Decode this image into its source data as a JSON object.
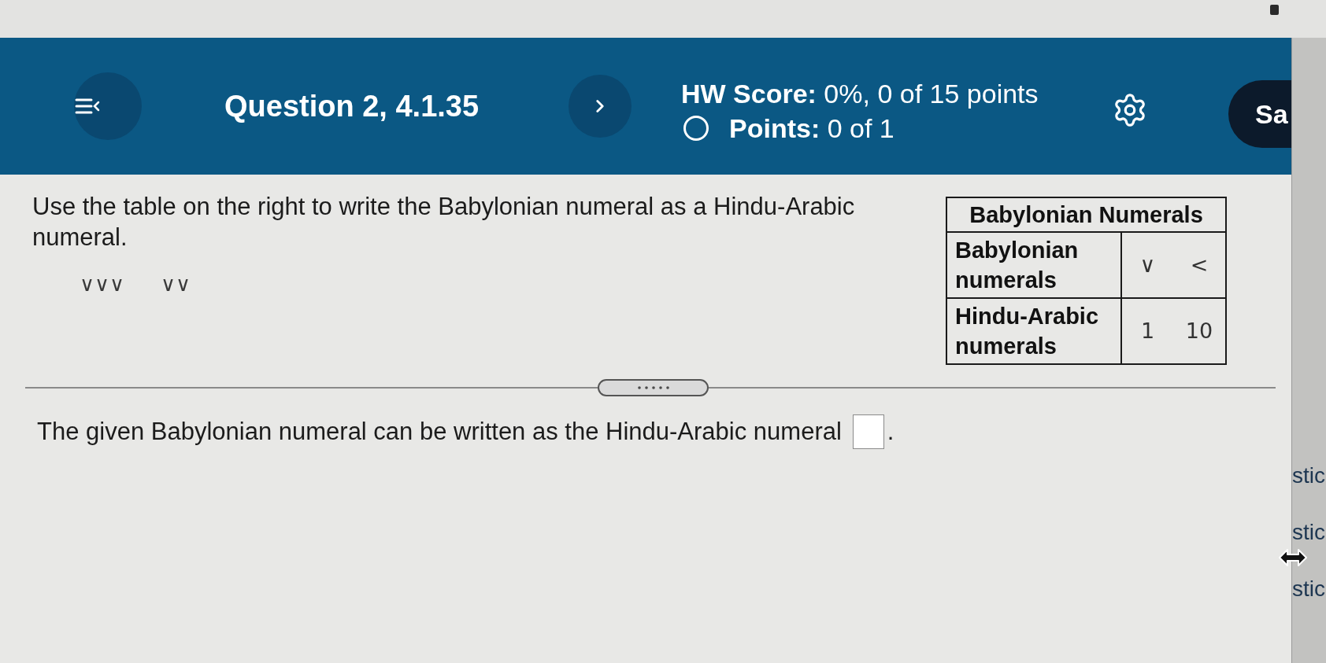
{
  "header": {
    "question_title": "Question 2, 4.1.35",
    "hw_score": "**HW Score:** 0%, 0 of 15 points",
    "points": "**Points:** 0 of 1",
    "save_button": "Sa"
  },
  "question": {
    "instruction": "Use the table on the right to write the Babylonian numeral as a Hindu-Arabic numeral.",
    "numeral_groups": [
      "∨∨∨",
      "∨∨"
    ]
  },
  "reference_table": {
    "title": "Babylonian Numerals",
    "rows": [
      {
        "label": "Babylonian numerals",
        "values": [
          "∨",
          "<"
        ]
      },
      {
        "label": "Hindu-Arabic numerals",
        "values": [
          "1",
          "10"
        ]
      }
    ]
  },
  "answer": {
    "text_before": "The given Babylonian numeral can be written as the Hindu-Arabic numeral",
    "text_after": "."
  },
  "side_panel": {
    "items": [
      "stic",
      "stic",
      "stic"
    ]
  }
}
